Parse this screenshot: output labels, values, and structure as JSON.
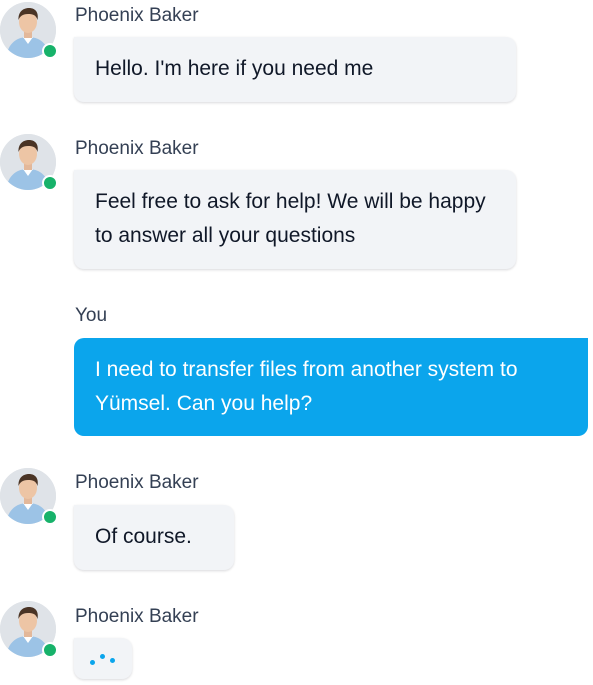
{
  "conversation": {
    "messages": [
      {
        "sender": "Phoenix Baker",
        "text": "Hello. I'm here if you need me",
        "online": true
      },
      {
        "sender": "Phoenix Baker",
        "text": "Feel free to ask for help! We will be happy to answer all your questions",
        "online": true
      },
      {
        "sender": "You",
        "text": "I need to transfer files from another system to Yümsel. Can you help?"
      },
      {
        "sender": "Phoenix Baker",
        "text": "Of course.",
        "online": true
      },
      {
        "sender": "Phoenix Baker",
        "typing": true,
        "online": true
      }
    ]
  },
  "colors": {
    "incoming_bubble": "#f2f4f7",
    "outgoing_bubble": "#0ba5ec",
    "online_status": "#17b26a",
    "typing_dots": "#0ba5ec"
  }
}
